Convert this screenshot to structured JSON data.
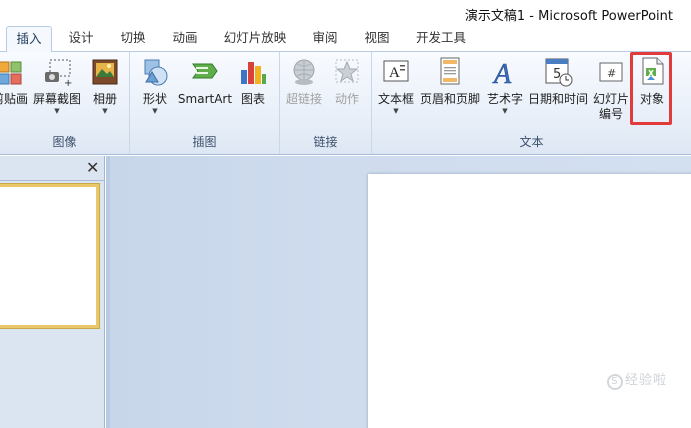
{
  "window": {
    "title": "演示文稿1 - Microsoft PowerPoint"
  },
  "tabs": [
    {
      "label": "插入",
      "active": true
    },
    {
      "label": "设计"
    },
    {
      "label": "切换"
    },
    {
      "label": "动画"
    },
    {
      "label": "幻灯片放映"
    },
    {
      "label": "审阅"
    },
    {
      "label": "视图"
    },
    {
      "label": "开发工具"
    }
  ],
  "ribbon": {
    "groups": {
      "images": "图像",
      "illustrations": "插图",
      "links": "链接",
      "text": "文本"
    },
    "buttons": {
      "clipart": "剪贴画",
      "screenshot": "屏幕截图",
      "album": "相册",
      "shapes": "形状",
      "smartart": "SmartArt",
      "chart": "图表",
      "hyperlink": "超链接",
      "action": "动作",
      "textbox": "文本框",
      "header_footer": "页眉和页脚",
      "wordart": "艺术字",
      "datetime": "日期和时间",
      "slide_number_1": "幻灯片",
      "slide_number_2": "编号",
      "object": "对象"
    }
  },
  "panel": {
    "close_glyph": "✕"
  },
  "watermark": "经验啦"
}
